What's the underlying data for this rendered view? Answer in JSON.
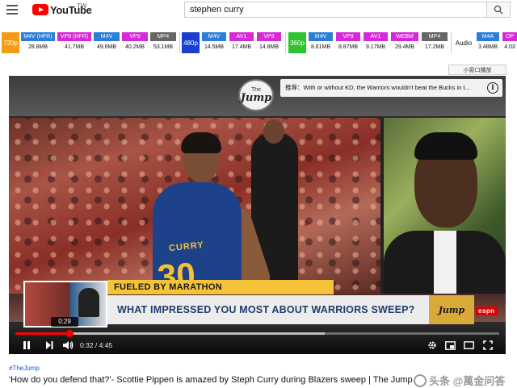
{
  "header": {
    "logo_text": "YouTube",
    "region": "TW",
    "search_value": "stephen curry"
  },
  "downloads": {
    "groups": [
      {
        "quality": "720p",
        "color": "#f39c12",
        "formats": [
          {
            "label": "M4V (HFR)",
            "size": "28.8MB",
            "color": "#2b7fd8"
          },
          {
            "label": "VP9 (HFR)",
            "size": "41.7MB",
            "color": "#d62ad6"
          },
          {
            "label": "M4V",
            "size": "49.6MB",
            "color": "#2b7fd8"
          },
          {
            "label": "VP9",
            "size": "40.2MB",
            "color": "#d62ad6"
          },
          {
            "label": "MP4",
            "size": "53.1MB",
            "color": "#666666"
          }
        ]
      },
      {
        "quality": "480p",
        "color": "#1a3ecf",
        "formats": [
          {
            "label": "M4V",
            "size": "14.5MB",
            "color": "#2b7fd8"
          },
          {
            "label": "AV1",
            "size": "17.4MB",
            "color": "#d62ad6"
          },
          {
            "label": "VP9",
            "size": "14.8MB",
            "color": "#d62ad6"
          }
        ]
      },
      {
        "quality": "360p",
        "color": "#2ec42e",
        "formats": [
          {
            "label": "M4V",
            "size": "8.61MB",
            "color": "#2b7fd8"
          },
          {
            "label": "VP9",
            "size": "8.87MB",
            "color": "#d62ad6"
          },
          {
            "label": "AV1",
            "size": "9.17MB",
            "color": "#d62ad6"
          },
          {
            "label": "WEBM",
            "size": "29.4MB",
            "color": "#d62ad6"
          },
          {
            "label": "MP4",
            "size": "17.2MB",
            "color": "#666666"
          }
        ]
      },
      {
        "quality": "Audio",
        "color": "#ffffff",
        "formats": [
          {
            "label": "M4A",
            "size": "3.48MB",
            "color": "#2b7fd8"
          },
          {
            "label": "OP",
            "size": "4.03",
            "color": "#d62ad6"
          }
        ]
      }
    ]
  },
  "player": {
    "mini_player_label": "小窗口播放",
    "recommendation": "推荐：With or without KD, the Warriors wouldn't beat the Bucks in t...",
    "logo_small": "The",
    "logo_big": "Jump",
    "jersey_name": "CURRY",
    "jersey_number": "30",
    "ticker_text": "FUELED BY MARATHON",
    "question_text": "WHAT IMPRESSED YOU MOST ABOUT WARRIORS SWEEP?",
    "badge_text": "Jump",
    "network": "espn",
    "preview_time": "0:29",
    "current_time": "0:32",
    "duration": "4:45",
    "time_display": "0:32 / 4:45",
    "progress_played": 0.1123,
    "progress_buffered": 0.64
  },
  "video": {
    "hashtag": "#TheJump",
    "title": "'How do you defend that?'- Scottie Pippen is amazed by Steph Curry during Blazers sweep | The Jump"
  },
  "watermark": "头条 @萬金问答"
}
